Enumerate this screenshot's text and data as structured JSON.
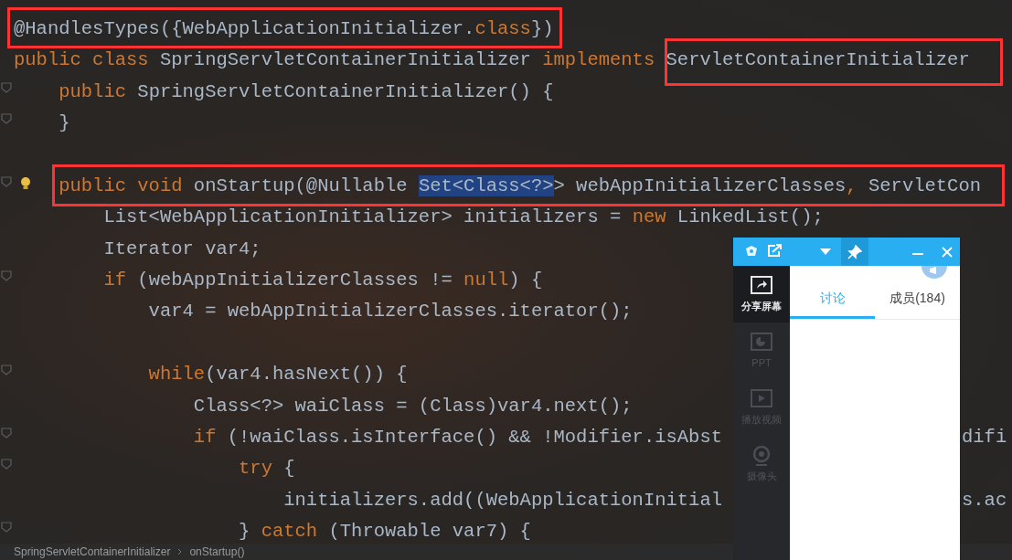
{
  "editor": {
    "lines": [
      {
        "tokens": [
          {
            "kind": "plain",
            "text": "@HandlesTypes({WebApplicationInitializer."
          },
          {
            "kind": "keyword",
            "text": "class"
          },
          {
            "kind": "plain",
            "text": "})"
          }
        ]
      },
      {
        "tokens": [
          {
            "kind": "keyword",
            "text": "public class"
          },
          {
            "kind": "plain",
            "text": " SpringServletContainerInitializer "
          },
          {
            "kind": "keyword",
            "text": "implements"
          },
          {
            "kind": "plain",
            "text": " ServletContainerInitializer"
          }
        ]
      },
      {
        "fold": true,
        "tokens": [
          {
            "kind": "keyword",
            "text": "    public"
          },
          {
            "kind": "plain",
            "text": " SpringServletContainerInitializer() {"
          }
        ]
      },
      {
        "fold": true,
        "tokens": [
          {
            "kind": "plain",
            "text": "    }"
          }
        ]
      },
      {
        "gap_before": true,
        "fold": true,
        "bulb": true,
        "tokens": [
          {
            "kind": "keyword",
            "text": "    public void"
          },
          {
            "kind": "plain",
            "text": " onStartup(@Nullable "
          },
          {
            "kind": "selection",
            "text": "Set<Class<?>"
          },
          {
            "kind": "plain",
            "text": "> webAppInitializerClasses"
          },
          {
            "kind": "keyword",
            "text": ","
          },
          {
            "kind": "plain",
            "text": " ServletCon"
          }
        ]
      },
      {
        "tokens": [
          {
            "kind": "plain",
            "text": "        List<WebApplicationInitializer> initializers = "
          },
          {
            "kind": "keyword",
            "text": "new"
          },
          {
            "kind": "plain",
            "text": " LinkedList();"
          }
        ]
      },
      {
        "tokens": [
          {
            "kind": "plain",
            "text": "        Iterator var4;"
          }
        ]
      },
      {
        "fold": true,
        "tokens": [
          {
            "kind": "keyword",
            "text": "        if"
          },
          {
            "kind": "plain",
            "text": " (webAppInitializerClasses != "
          },
          {
            "kind": "keyword",
            "text": "null"
          },
          {
            "kind": "plain",
            "text": ") {"
          }
        ]
      },
      {
        "tokens": [
          {
            "kind": "plain",
            "text": "            var4 = webAppInitializerClasses.iterator();"
          }
        ]
      },
      {
        "gap_before": true,
        "fold": true,
        "tokens": [
          {
            "kind": "keyword",
            "text": "            while"
          },
          {
            "kind": "plain",
            "text": "(var4.hasNext()) {"
          }
        ]
      },
      {
        "tokens": [
          {
            "kind": "plain",
            "text": "                Class<?> waiClass = (Class)var4.next();"
          }
        ]
      },
      {
        "fold": true,
        "tail": "difi",
        "tokens": [
          {
            "kind": "keyword",
            "text": "                if"
          },
          {
            "kind": "plain",
            "text": " (!waiClass.isInterface() && !Modifier.isAbst"
          }
        ]
      },
      {
        "fold": true,
        "tokens": [
          {
            "kind": "keyword",
            "text": "                    try"
          },
          {
            "kind": "plain",
            "text": " {"
          }
        ]
      },
      {
        "tail": "s.ac",
        "tokens": [
          {
            "kind": "plain",
            "text": "                        initializers.add((WebApplicationInitial"
          }
        ]
      },
      {
        "fold": true,
        "tokens": [
          {
            "kind": "plain",
            "text": "                    } "
          },
          {
            "kind": "keyword",
            "text": "catch"
          },
          {
            "kind": "plain",
            "text": " (Throwable var7) {"
          }
        ]
      }
    ]
  },
  "breadcrumb": [
    "SpringServletContainerInitializer",
    "onStartup()"
  ],
  "chat_window": {
    "tools": [
      {
        "kind": "share",
        "label": "分享屏幕",
        "selected": true
      },
      {
        "kind": "slides",
        "label": "PPT",
        "selected": false
      },
      {
        "kind": "video",
        "label": "播放视频",
        "selected": false
      },
      {
        "kind": "camera",
        "label": "摄像头",
        "selected": false
      }
    ],
    "tabs": [
      {
        "label": "讨论",
        "selected": true
      },
      {
        "label": "成员(184)",
        "selected": false
      }
    ]
  }
}
